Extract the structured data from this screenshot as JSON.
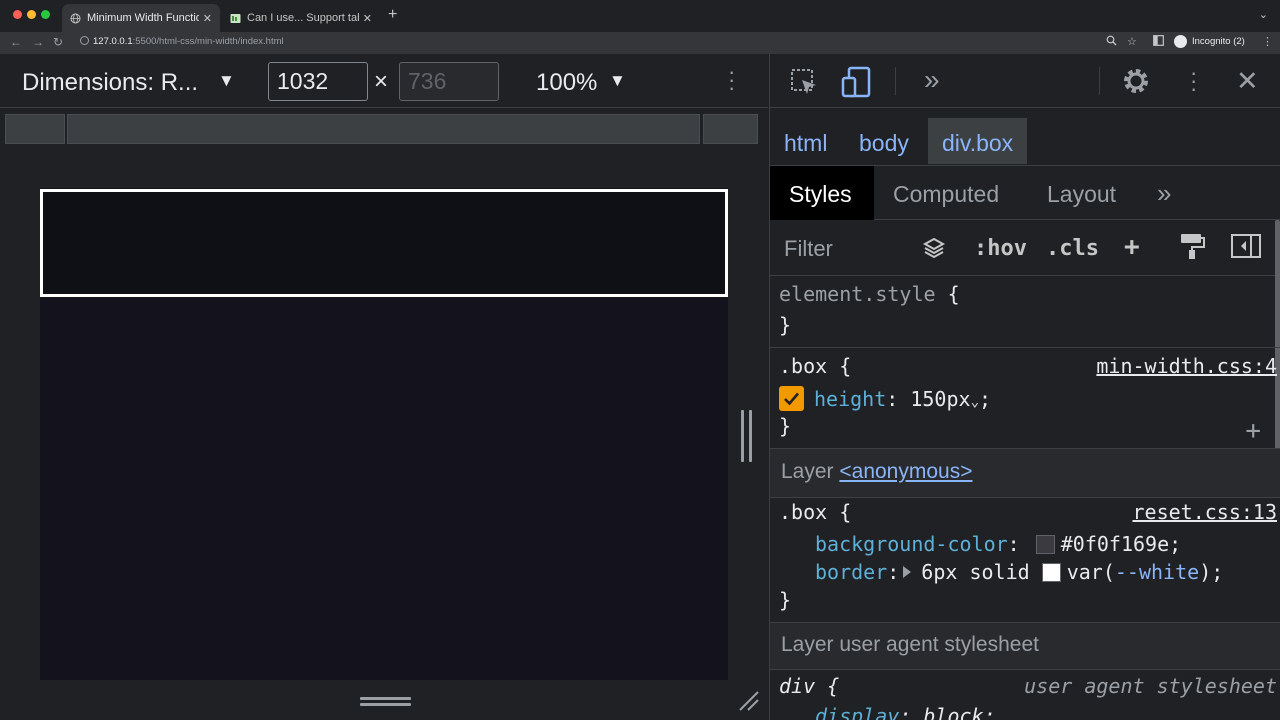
{
  "browser": {
    "tabs": [
      {
        "title": "Minimum Width Function",
        "active": true,
        "favicon": "globe-icon"
      },
      {
        "title": "Can I use... Support tabl",
        "active": false,
        "favicon": "caniuse-icon"
      }
    ],
    "url_host": "127.0.0.1",
    "url_rest": ":5500/html-css/min-width/index.html",
    "incognito_label": "Incognito (2)"
  },
  "device_toolbar": {
    "dimensions_label": "Dimensions: R...",
    "width": "1032",
    "height_placeholder": "736",
    "times": "×",
    "zoom": "100%"
  },
  "devtools": {
    "breadcrumbs": [
      "html",
      "body",
      "div.box"
    ],
    "tabs": [
      "Styles",
      "Computed",
      "Layout"
    ],
    "more_tabs": "»",
    "filter_placeholder": "Filter",
    "filter_tools": {
      "hov": ":hov",
      "cls": ".cls",
      "add": "+"
    },
    "rules": {
      "element_style": {
        "selector": "element.style",
        "open": " {",
        "close": "}"
      },
      "box_main": {
        "selector": ".box",
        "open": " {",
        "source": "min-width.css:4",
        "property": "height",
        "value": "150px",
        "value_suffix": ";",
        "close": "}"
      },
      "layer_anonymous": {
        "prefix": "Layer ",
        "link": "<anonymous>"
      },
      "box_reset": {
        "selector": ".box",
        "open": " {",
        "source": "reset.css:13",
        "bg_property": "background-color",
        "bg_value": "#0f0f169e;",
        "border_property": "border",
        "border_value_pre": "6px solid ",
        "border_var_open": "var(",
        "border_var_name": "--white",
        "border_var_close": ");",
        "close": "}"
      },
      "layer_ua": {
        "text": "Layer user agent stylesheet"
      },
      "ua_div": {
        "selector": "div",
        "open": " {",
        "source": "user agent stylesheet",
        "property": "display",
        "value": "block;"
      }
    }
  },
  "colors": {
    "box_border": "#ffffff",
    "box_background": "#0f0f169e",
    "checkbox": "#f29900",
    "link": "#8ab4f8",
    "property": "#5db0d7"
  }
}
